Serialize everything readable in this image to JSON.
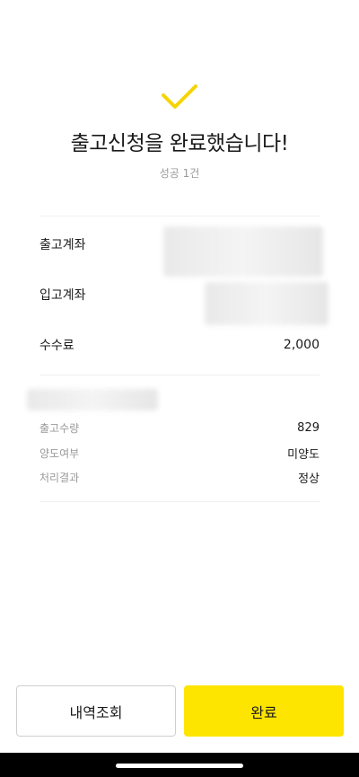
{
  "header": {
    "title": "출고신청을 완료했습니다!",
    "subtitle": "성공 1건"
  },
  "summary": {
    "withdraw_account_label": "출고계좌",
    "deposit_account_label": "입고계좌",
    "fee_label": "수수료",
    "fee_value": "2,000"
  },
  "details": {
    "quantity_label": "출고수량",
    "quantity_value": "829",
    "transfer_label": "양도여부",
    "transfer_value": "미양도",
    "result_label": "처리결과",
    "result_value": "정상"
  },
  "actions": {
    "history_label": "내역조회",
    "done_label": "완료"
  },
  "colors": {
    "accent": "#fee500",
    "check": "#f5d400"
  }
}
